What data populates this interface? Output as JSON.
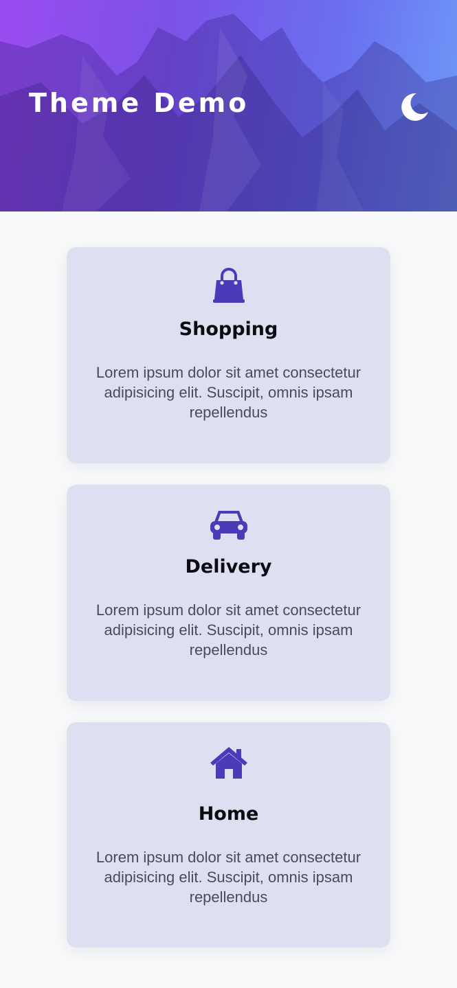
{
  "header": {
    "title": "Theme Demo",
    "toggle_icon": "moon-icon",
    "gradient": [
      "#9b4cf0",
      "#7c52e8",
      "#6a6ff0",
      "#6f9af8"
    ]
  },
  "cards": [
    {
      "icon": "shopping-bag-icon",
      "title": "Shopping",
      "text": "Lorem ipsum dolor sit amet consectetur adipisicing elit. Suscipit, omnis ipsam repellendus"
    },
    {
      "icon": "car-icon",
      "title": "Delivery",
      "text": "Lorem ipsum dolor sit amet consectetur adipisicing elit. Suscipit, omnis ipsam repellendus"
    },
    {
      "icon": "home-icon",
      "title": "Home",
      "text": "Lorem ipsum dolor sit amet consectetur adipisicing elit. Suscipit, omnis ipsam repellendus"
    }
  ],
  "colors": {
    "accent": "#4a3bb8",
    "card_bg": "#dedff0",
    "page_bg": "#f8f9fa"
  }
}
